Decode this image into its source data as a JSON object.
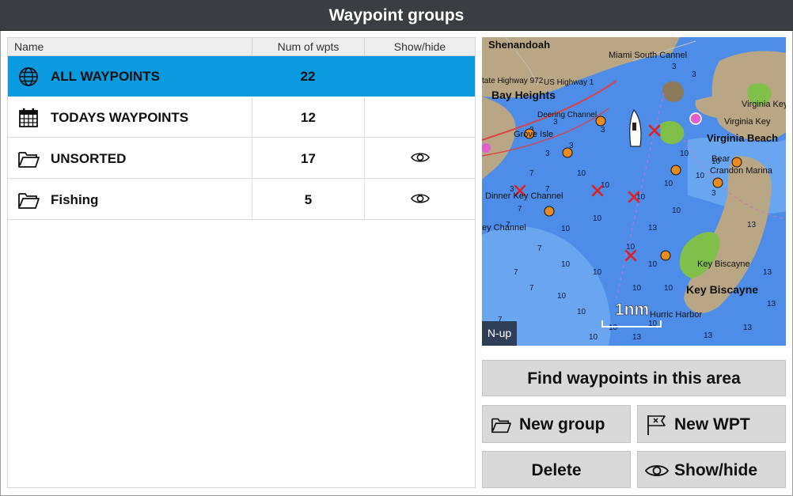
{
  "window": {
    "title": "Waypoint groups"
  },
  "list": {
    "columns": {
      "name": "Name",
      "num": "Num of wpts",
      "show": "Show/hide"
    },
    "rows": [
      {
        "name": "ALL WAYPOINTS",
        "count": "22",
        "icon": "globe-icon",
        "visible_icon": false,
        "selected": true
      },
      {
        "name": "TODAYS WAYPOINTS",
        "count": "12",
        "icon": "calendar-icon",
        "visible_icon": false,
        "selected": false
      },
      {
        "name": "UNSORTED",
        "count": "17",
        "icon": "folder-icon",
        "visible_icon": true,
        "selected": false
      },
      {
        "name": "Fishing",
        "count": "5",
        "icon": "folder-icon",
        "visible_icon": true,
        "selected": false
      }
    ]
  },
  "map": {
    "labels": {
      "shenandoah": "Shenandoah",
      "miami_south_channel": "Miami South Cannel",
      "bay_heights": "Bay Heights",
      "state_highway": "tate Highway 972",
      "us_highway": "US Highway 1",
      "deering_channel": "Deering Channel",
      "grove_isle": "Grove Isle",
      "virginia_key": "Virginia Key",
      "virginia_key_2": "Virginia Key",
      "virginia_beach": "Virginia Beach",
      "bear_cut": "Bear",
      "crandon_marina": "Crandon Marina",
      "dinner_key_channel": "Dinner Key Channel",
      "channel": "ey Channel",
      "key_biscayne_small": "Key Biscayne",
      "key_biscayne": "Key Biscayne",
      "hurricane_harbor": "Hurric    Harbor"
    },
    "scale": "1nm",
    "orientation": "N-up",
    "colors": {
      "water": "#4d8de8",
      "shallow": "#7fb6f2",
      "land": "#b8a684",
      "green": "#7fbf4a"
    }
  },
  "buttons": {
    "find": "Find waypoints in this area",
    "new_group": "New group",
    "new_wpt": "New WPT",
    "delete": "Delete",
    "show_hide": "Show/hide"
  },
  "colors": {
    "selected_row": "#0a9ae0",
    "titlebar": "#3b3d42",
    "button": "#d9d9d9"
  }
}
